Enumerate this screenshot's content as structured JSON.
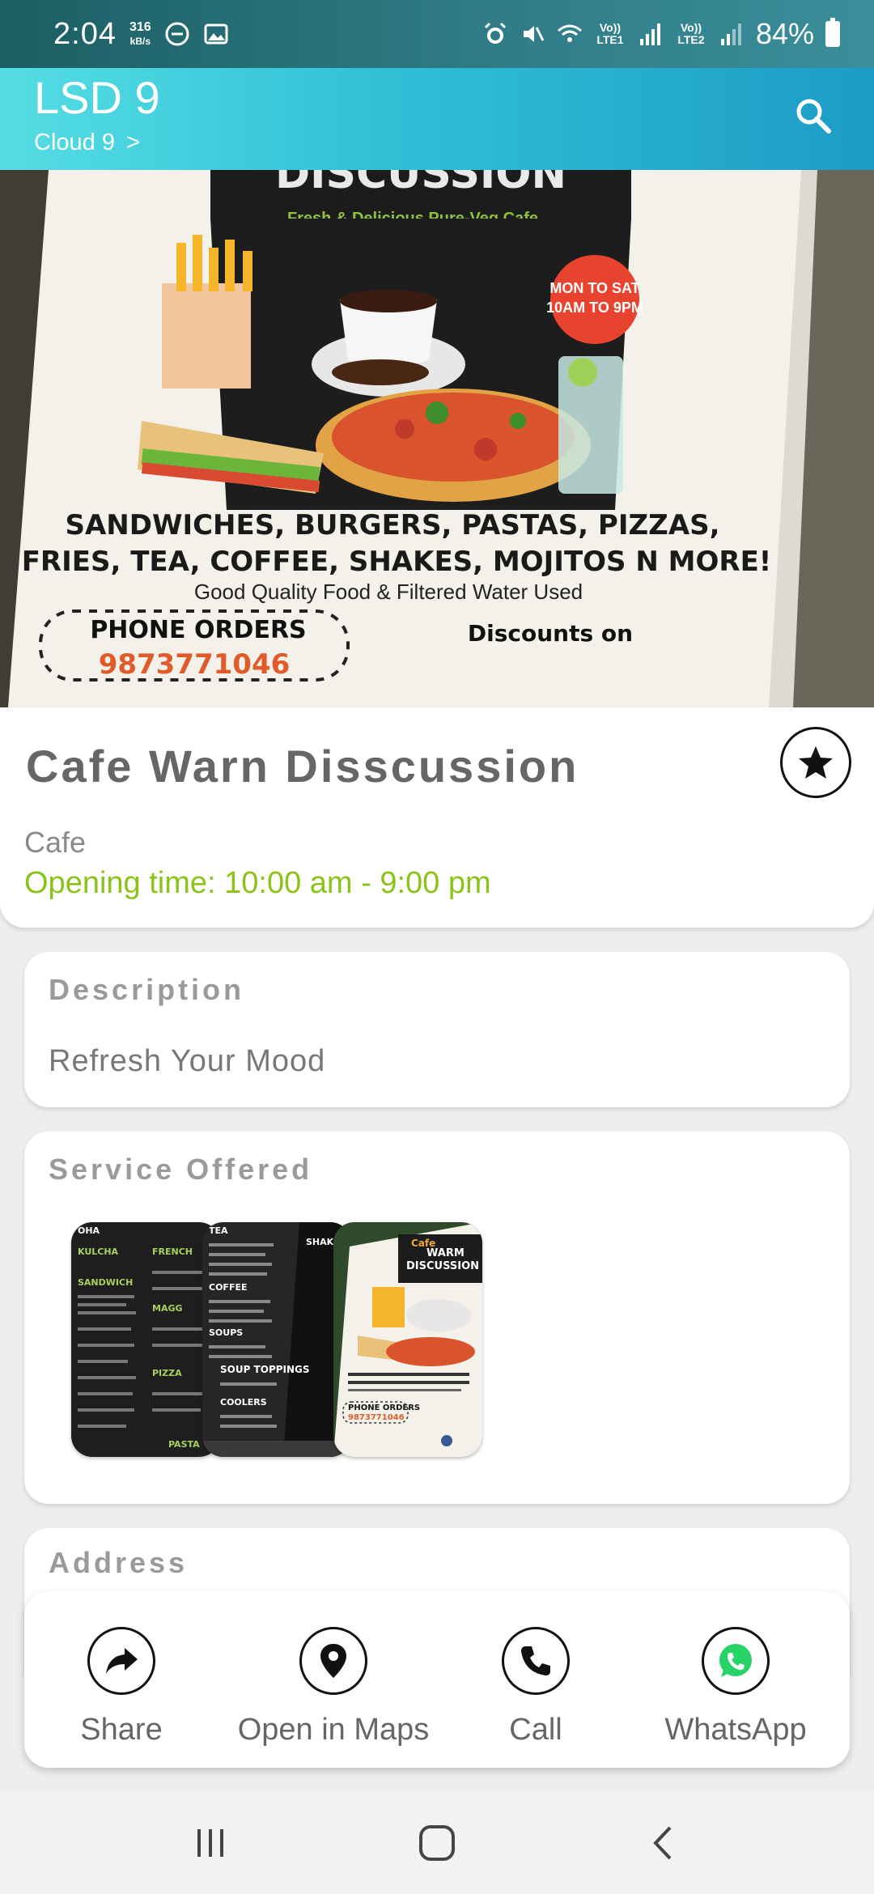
{
  "status_bar": {
    "time": "2:04",
    "speed_value": "316",
    "speed_unit": "kB/s",
    "sim1": "Vo)) LTE1",
    "sim2": "Vo)) LTE2",
    "battery": "84%"
  },
  "app_bar": {
    "title": "LSD 9",
    "subtitle": "Cloud 9",
    "subtitle_chevron": ">"
  },
  "hero": {
    "banner_title": "DISCUSSION",
    "banner_tagline": "Fresh & Delicious Pure-Veg Cafe",
    "badge_line1": "MON TO SAT",
    "badge_line2": "10AM TO 9PM",
    "menu_line1": "SANDWICHES, BURGERS, PASTAS, PIZZAS,",
    "menu_line2": "FRIES, TEA, COFFEE, SHAKES, MOJITOS N MORE!",
    "quality": "Good Quality Food & Filtered Water Used",
    "phone_orders": "PHONE ORDERS",
    "phone_number": "9873771046",
    "discounts": "Discounts on"
  },
  "place": {
    "name": "Cafe Warn Disscussion",
    "category": "Cafe",
    "opening_time": "Opening time: 10:00 am - 9:00 pm"
  },
  "description": {
    "label": "Description",
    "text": "Refresh Your Mood"
  },
  "services": {
    "label": "Service Offered",
    "thumb1_words": [
      "OHA",
      "KULCHA",
      "SANDWICH",
      "PIZZA",
      "PASTA",
      "FRENCH",
      "MAGG"
    ],
    "thumb2_words": [
      "TEA",
      "SHAKES",
      "COFFEE",
      "SOUPS",
      "SOUP TOPPINGS",
      "COOLERS"
    ],
    "thumb3_words": [
      "Cafe",
      "WARM",
      "DISCUSSION",
      "PHONE ORDERS",
      "9873771046"
    ]
  },
  "address": {
    "label": "Address"
  },
  "actions": [
    {
      "label": "Share",
      "icon": "share-icon"
    },
    {
      "label": "Open in Maps",
      "icon": "map-pin-icon"
    },
    {
      "label": "Call",
      "icon": "phone-icon"
    },
    {
      "label": "WhatsApp",
      "icon": "whatsapp-icon"
    }
  ],
  "colors": {
    "app_bar_start": "#55dde4",
    "app_bar_end": "#1d9cc6",
    "opening_time": "#8ac418",
    "whatsapp": "#25d366",
    "badge": "#e8432e"
  }
}
